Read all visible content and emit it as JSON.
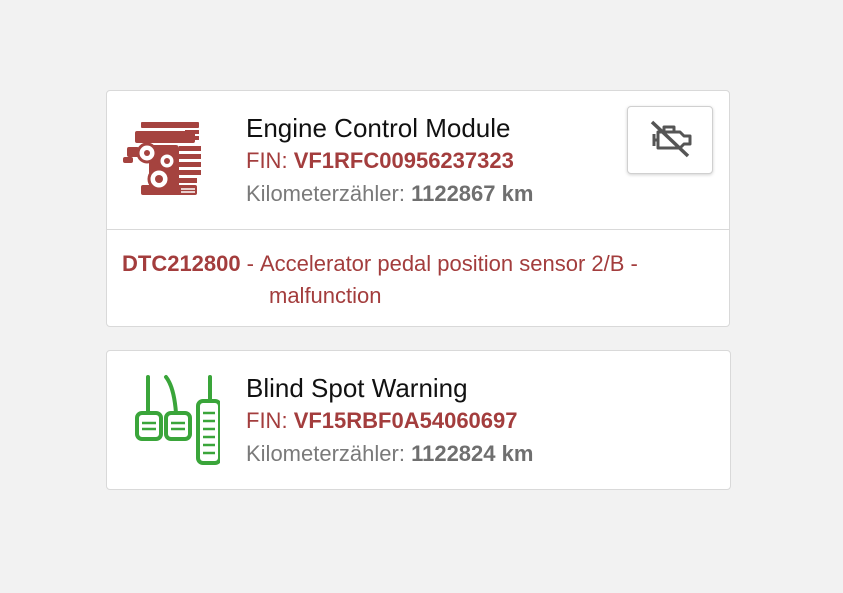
{
  "cards": [
    {
      "title": "Engine Control Module",
      "fin_label": "FIN:",
      "fin_value": "VF1RFC00956237323",
      "km_label": "Kilometerzähler:",
      "km_value": "1122867 km",
      "icon": "engine-icon",
      "action_icon": "engine-off-icon",
      "dtc": {
        "code": "DTC212800",
        "separator": "-",
        "description_line1": "Accelerator pedal position sensor 2/B -",
        "description_line2": "malfunction"
      }
    },
    {
      "title": "Blind Spot Warning",
      "fin_label": "FIN:",
      "fin_value": "VF15RBF0A54060697",
      "km_label": "Kilometerzähler:",
      "km_value": "1122824 km",
      "icon": "pedals-icon"
    }
  ],
  "colors": {
    "accent_red": "#a33d3d",
    "icon_green": "#3aa53a",
    "engine_icon_red": "#a5433f",
    "muted_gray": "#7a7a7a"
  }
}
